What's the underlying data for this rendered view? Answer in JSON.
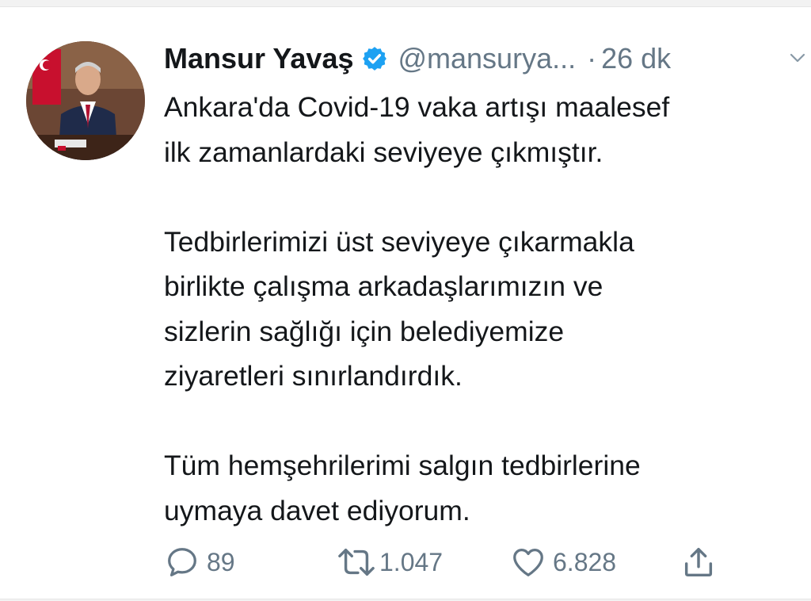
{
  "tweet": {
    "author_name": "Mansur Yavaş",
    "handle": "@mansurya...",
    "separator": "·",
    "time": "26 dk",
    "paragraphs": [
      [
        "Ankara'da Covid-19 vaka artışı maalesef",
        "ilk zamanlardaki seviyeye çıkmıştır."
      ],
      [
        "Tedbirlerimizi üst seviyeye çıkarmakla",
        "birlikte çalışma arkadaşlarımızın ve",
        "sizlerin sağlığı için belediyemize",
        "ziyaretleri sınırlandırdık."
      ],
      [
        "Tüm hemşehrilerimi salgın tedbirlerine",
        "uymaya davet ediyorum."
      ]
    ]
  },
  "actions": {
    "replies": "89",
    "retweets": "1.047",
    "likes": "6.828"
  },
  "icons": {
    "verified": "verified-badge-icon",
    "menu": "chevron-down-icon",
    "reply": "reply-icon",
    "retweet": "retweet-icon",
    "like": "heart-icon",
    "share": "share-icon"
  },
  "colors": {
    "verified": "#1da1f2",
    "text": "#14171a",
    "secondary": "#657786"
  }
}
